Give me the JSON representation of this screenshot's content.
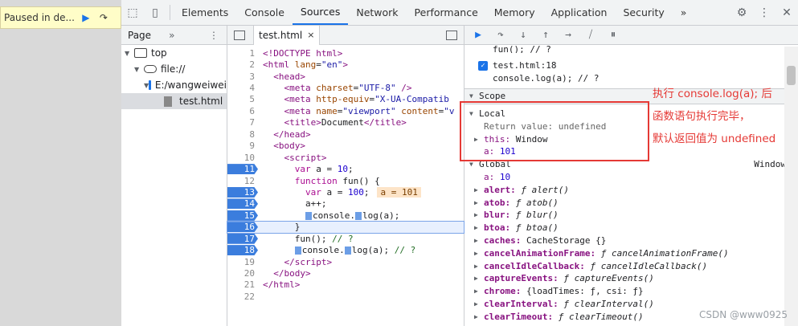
{
  "banner": {
    "paused_text": "Paused in de...",
    "resume_icon": "resume-icon",
    "step_icon": "step-over-icon"
  },
  "tabs": {
    "items": [
      "Elements",
      "Console",
      "Sources",
      "Network",
      "Performance",
      "Memory",
      "Application",
      "Security"
    ],
    "active": "Sources",
    "more": "»",
    "icons": [
      "inspect-icon",
      "device-toggle-icon",
      "settings-icon",
      "kebab-icon",
      "close-icon"
    ]
  },
  "navigator": {
    "tab": "Page",
    "more": "»",
    "tree": [
      {
        "label": "top",
        "icon": "frame-icon"
      },
      {
        "label": "file://",
        "icon": "cloud-icon"
      },
      {
        "label": "E:/wangweiwei",
        "icon": "folder-icon"
      },
      {
        "label": "test.html",
        "icon": "file-icon"
      }
    ]
  },
  "editor": {
    "file_tab": "test.html",
    "close": "×",
    "inline_value": "a = 101",
    "lines": [
      {
        "n": "1",
        "html": "<span class=\"tg\">&lt;!DOCTYPE html&gt;</span>"
      },
      {
        "n": "2",
        "html": "<span class=\"tg\">&lt;html</span> <span class=\"at\">lang</span>=<span class=\"av\">\"en\"</span><span class=\"tg\">&gt;</span>"
      },
      {
        "n": "3",
        "html": "  <span class=\"tg\">&lt;head&gt;</span>"
      },
      {
        "n": "4",
        "html": "    <span class=\"tg\">&lt;meta</span> <span class=\"at\">charset</span>=<span class=\"av\">\"UTF-8\"</span> <span class=\"tg\">/&gt;</span>"
      },
      {
        "n": "5",
        "html": "    <span class=\"tg\">&lt;meta</span> <span class=\"at\">http-equiv</span>=<span class=\"av\">\"X-UA-Compatib</span>"
      },
      {
        "n": "6",
        "html": "    <span class=\"tg\">&lt;meta</span> <span class=\"at\">name</span>=<span class=\"av\">\"viewport\"</span> <span class=\"at\">content</span>=<span class=\"av\">\"v</span>"
      },
      {
        "n": "7",
        "html": "    <span class=\"tg\">&lt;title&gt;</span>Document<span class=\"tg\">&lt;/title&gt;</span>"
      },
      {
        "n": "8",
        "html": "  <span class=\"tg\">&lt;/head&gt;</span>"
      },
      {
        "n": "9",
        "html": "  <span class=\"tg\">&lt;body&gt;</span>"
      },
      {
        "n": "10",
        "html": "    <span class=\"tg\">&lt;script&gt;</span>"
      },
      {
        "n": "11",
        "bp": true,
        "html": "      <span class=\"kw\">var</span> a = <span class=\"num\">10</span>;"
      },
      {
        "n": "12",
        "html": "      <span class=\"kw\">function</span> fun() {"
      },
      {
        "n": "13",
        "bp": true,
        "inline": true,
        "html": "        <span class=\"kw\">var</span> a = <span class=\"num\">100</span>;"
      },
      {
        "n": "14",
        "bp": true,
        "html": "        a++;"
      },
      {
        "n": "15",
        "bp": true,
        "html": "        <span class=\"bpmark\"></span>console.<span class=\"bpmark\"></span>log(a);"
      },
      {
        "n": "16",
        "bp": true,
        "current": true,
        "html": "      }"
      },
      {
        "n": "17",
        "bp": true,
        "html": "      fun(); <span class=\"cm\">// ?</span>"
      },
      {
        "n": "18",
        "bp": true,
        "html": "      <span class=\"bpmark\"></span>console.<span class=\"bpmark\"></span>log(a); <span class=\"cm\">// ?</span>"
      },
      {
        "n": "19",
        "html": "    <span class=\"tg\">&lt;/script&gt;</span>"
      },
      {
        "n": "20",
        "html": "  <span class=\"tg\">&lt;/body&gt;</span>"
      },
      {
        "n": "21",
        "html": "<span class=\"tg\">&lt;/html&gt;</span>"
      },
      {
        "n": "22",
        "html": ""
      }
    ]
  },
  "debugger": {
    "top_partial": "fun(); // ?",
    "breakpoint_file": "test.html:18",
    "breakpoint_code": "console.log(a); // ?",
    "scope_title": "Scope",
    "local_label": "Local",
    "return_value_key": "Return value:",
    "return_value": "undefined",
    "this_key": "this:",
    "this_value": "Window",
    "a_key": "a:",
    "a_value": "101",
    "global_label": "Global",
    "global_value": "Window",
    "global_props": [
      {
        "k": "a:",
        "v": "10",
        "fn": false
      },
      {
        "k": "alert:",
        "v": "ƒ alert()",
        "fn": true
      },
      {
        "k": "atob:",
        "v": "ƒ atob()",
        "fn": true
      },
      {
        "k": "blur:",
        "v": "ƒ blur()",
        "fn": true
      },
      {
        "k": "btoa:",
        "v": "ƒ btoa()",
        "fn": true
      },
      {
        "k": "caches:",
        "v": "CacheStorage {}",
        "fn": false
      },
      {
        "k": "cancelAnimationFrame:",
        "v": "ƒ cancelAnimationFrame()",
        "fn": true
      },
      {
        "k": "cancelIdleCallback:",
        "v": "ƒ cancelIdleCallback()",
        "fn": true
      },
      {
        "k": "captureEvents:",
        "v": "ƒ captureEvents()",
        "fn": true
      },
      {
        "k": "chrome:",
        "v": "{loadTimes: ƒ, csi: ƒ}",
        "fn": false
      },
      {
        "k": "clearInterval:",
        "v": "ƒ clearInterval()",
        "fn": true
      },
      {
        "k": "clearTimeout:",
        "v": "ƒ clearTimeout()",
        "fn": true
      }
    ]
  },
  "annotation": {
    "line1": "执行 console.log(a); 后",
    "line2": "函数语句执行完毕，",
    "line3": "默认返回值为 undefined",
    "color": "#e53935"
  },
  "watermark": "CSDN @www0925"
}
